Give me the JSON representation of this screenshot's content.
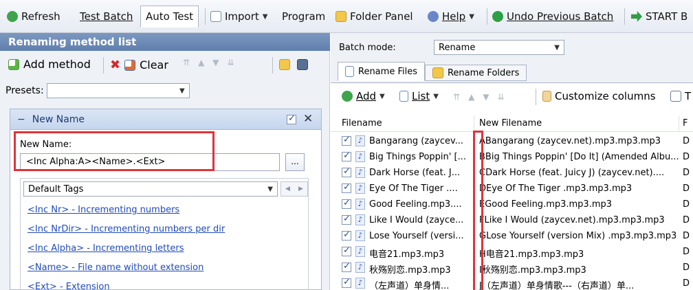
{
  "toolbar": {
    "refresh": "Refresh",
    "test_batch": "Test Batch",
    "auto_test": "Auto Test",
    "import": "Import",
    "program": "Program",
    "folder_panel": "Folder Panel",
    "help": "Help",
    "undo_previous_batch": "Undo Previous Batch",
    "start_batch": "START B"
  },
  "left_panel": {
    "title": "Renaming method list",
    "add_method": "Add method",
    "clear": "Clear",
    "presets_label": "Presets:",
    "presets_value": "",
    "method": {
      "title": "New Name",
      "enabled": true,
      "field_label": "New Name:",
      "field_value": "<Inc Alpha:A><Name>.<Ext>",
      "browse_label": "...",
      "tags_select": "Default Tags",
      "tags": [
        "<Inc Nr> - Incrementing numbers",
        "<Inc NrDir> - Incrementing numbers per dir",
        "<Inc Alpha> - Incrementing letters",
        "<Name> - File name without extension",
        "<Ext> - Extension"
      ]
    }
  },
  "right_panel": {
    "batch_mode_label": "Batch mode:",
    "batch_mode_value": "Rename",
    "tabs": [
      "Rename Files",
      "Rename Folders"
    ],
    "add": "Add",
    "list": "List",
    "customize_columns": "Customize columns",
    "last_tool": "T",
    "columns": [
      "Filename",
      "New Filename",
      "F"
    ],
    "rows": [
      {
        "checked": true,
        "filename": "Bangarang (zaycev...",
        "new_filename": "ABangarang (zaycev.net).mp3.mp3.mp3",
        "extra": "D"
      },
      {
        "checked": true,
        "filename": "Big Things Poppin' [...",
        "new_filename": "BBig Things Poppin' [Do It] (Amended Albu...",
        "extra": "D"
      },
      {
        "checked": true,
        "filename": "Dark Horse (feat. J...",
        "new_filename": "CDark Horse (feat. Juicy J) (zaycev.net)....",
        "extra": "D"
      },
      {
        "checked": true,
        "filename": "Eye Of The Tiger ....",
        "new_filename": "DEye Of The Tiger  .mp3.mp3.mp3",
        "extra": "D"
      },
      {
        "checked": true,
        "filename": "Good Feeling.mp3....",
        "new_filename": "EGood Feeling.mp3.mp3.mp3",
        "extra": "D"
      },
      {
        "checked": true,
        "filename": "Like I Would (zayce...",
        "new_filename": "FLike I Would (zaycev.net).mp3.mp3.mp3",
        "extra": "D"
      },
      {
        "checked": true,
        "filename": "Lose Yourself (versi...",
        "new_filename": "GLose Yourself (version Mix) .mp3.mp3.mp3",
        "extra": "D"
      },
      {
        "checked": true,
        "filename": "电音21.mp3.mp3",
        "new_filename": "H电音21.mp3.mp3.mp3",
        "extra": "D"
      },
      {
        "checked": true,
        "filename": "秋殇别恋.mp3.mp3",
        "new_filename": "I秋殇别恋.mp3.mp3.mp3",
        "extra": "D"
      },
      {
        "checked": true,
        "filename": "（左声道）单身情...",
        "new_filename": "J（左声道）单身情歌---（右声道）单...",
        "extra": "D"
      }
    ]
  },
  "colors": {
    "highlight_red": "#e0323a",
    "panel_title_blue": "#5f7fae",
    "link_blue": "#1f4ab8"
  }
}
